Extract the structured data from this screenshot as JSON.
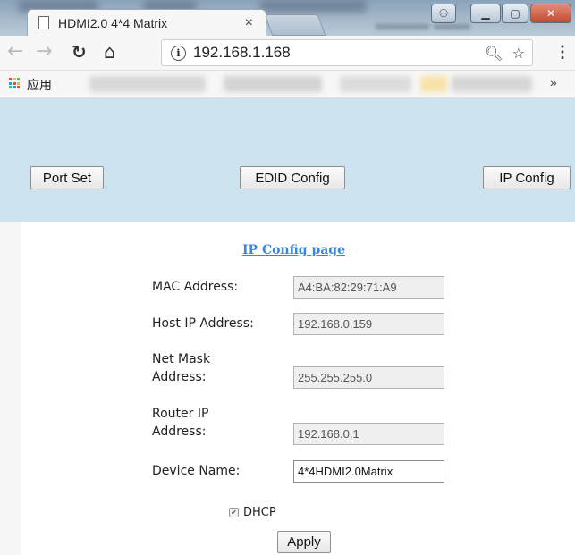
{
  "browser": {
    "tab_title": "HDMI2.0 4*4 Matrix",
    "tab_close": "×",
    "url": "192.168.1.168",
    "bookmarks_apps_label": "应用",
    "bookmarks_more": "»",
    "window_controls": [
      "restore-icon",
      "minimize-icon",
      "maximize-icon",
      "close-icon"
    ]
  },
  "nav": {
    "port_set": "Port Set",
    "edid_config": "EDID Config",
    "ip_config": "IP Config"
  },
  "form": {
    "title": "IP Config page",
    "mac_label": "MAC Address:",
    "mac_value": "A4:BA:82:29:71:A9",
    "host_ip_label": "Host IP Address:",
    "host_ip_value": "192.168.0.159",
    "netmask_label_1": "Net Mask",
    "netmask_label_2": "Address:",
    "netmask_value": "255.255.255.0",
    "router_label_1": "Router IP",
    "router_label_2": "Address:",
    "router_value": "192.168.0.1",
    "device_name_label": "Device Name:",
    "device_name_value": "4*4HDMI2.0Matrix",
    "dhcp_label": "DHCP",
    "dhcp_checked": true,
    "apply": "Apply"
  },
  "colors": {
    "panel_blue": "#cde4f0",
    "link_blue": "#3b87e0"
  }
}
